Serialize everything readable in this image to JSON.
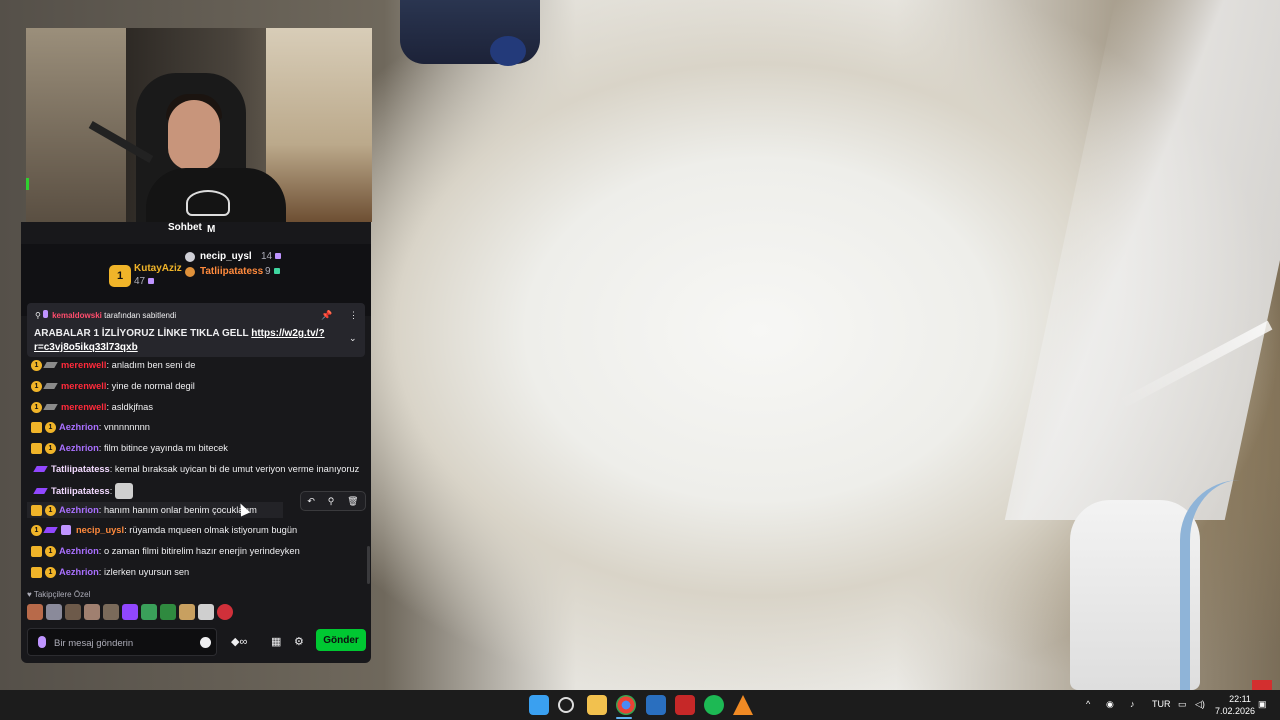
{
  "chat": {
    "title": "Sohbet",
    "title_suffix": "M",
    "leaderboard": {
      "first": {
        "rank": "1",
        "name": "KutayAziz",
        "count": "47"
      },
      "second": {
        "name": "necip_uysl",
        "count": "14"
      },
      "third": {
        "name": "Tatliipatatess",
        "count": "9"
      }
    },
    "pinned": {
      "pinned_by": "kemaldowski",
      "pinned_suffix": "tarafından sabitlendi",
      "text": "ARABALAR 1 İZLİYORUZ LİNKE TIKLA GELL",
      "link": "https://w2g.tv/?r=c3vj8o5ikq33l73qxb"
    },
    "messages": [
      {
        "user": "merenwell",
        "text": ": anladım ben seni de"
      },
      {
        "user": "merenwell",
        "text": ": yine de normal degil"
      },
      {
        "user": "merenwell",
        "text": ": asldkjfnas"
      },
      {
        "user": "Aezhrion",
        "text": ": vnnnnnnnn"
      },
      {
        "user": "Aezhrion",
        "text": ": film bitince yayında mı bitecek"
      },
      {
        "user": "Tatliipatatess",
        "text": ": kemal bıraksak uyican bi de umut veriyon verme inanıyoruz"
      },
      {
        "user": "Tatliipatatess",
        "text": ":"
      },
      {
        "user": "Aezhrion",
        "text": ": hanım hanım onlar benim çocuklarım"
      },
      {
        "user": "necip_uysl",
        "text": ": rüyamda mqueen olmak istiyorum bugün"
      },
      {
        "user": "Aezhrion",
        "text": ": o zaman filmi bitirelim hazır enerjin yerindeyken"
      },
      {
        "user": "Aezhrion",
        "text": ": izlerken uyursun sen"
      }
    ],
    "followers_only": "Takipçilere Özel",
    "input_placeholder": "Bir mesaj gönderin",
    "send_label": "Gönder"
  },
  "taskbar": {
    "language": "TUR",
    "time": "22:11",
    "date": "7.02.2026"
  },
  "colors": {
    "accent_send": "#00c832",
    "username_red": "#ff2a3b",
    "username_purple": "#a970ff",
    "username_orange": "#ff8a3d",
    "badge_gold": "#f0b429"
  }
}
